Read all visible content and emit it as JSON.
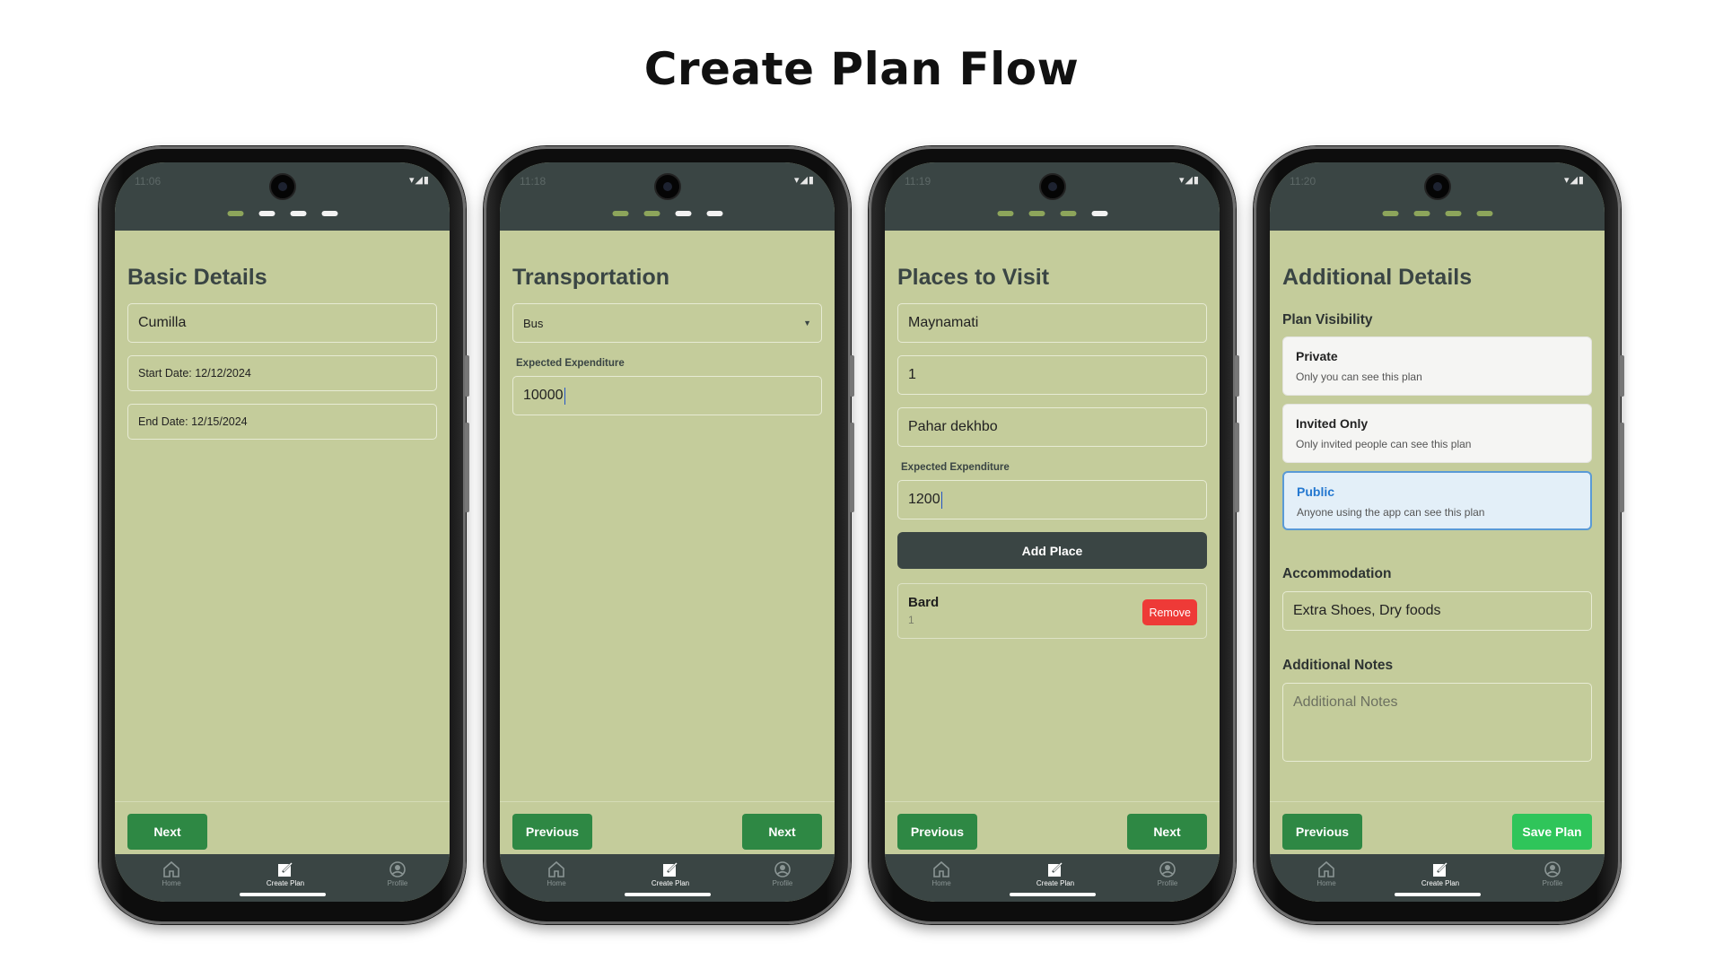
{
  "title": "Create Plan Flow",
  "tabs": {
    "home": "Home",
    "create": "Create Plan",
    "profile": "Profile"
  },
  "status_icons": "▾◢▮",
  "colors": {
    "accent_green": "#2e8844",
    "save_green": "#2fc55a",
    "header_dark": "#3a4544",
    "screen_bg": "#c4cc9b",
    "remove_red": "#ee3a37",
    "selected_blue": "#2478d0"
  },
  "screens": [
    {
      "time": "11:06",
      "step": 1,
      "heading": "Basic Details",
      "location": "Cumilla",
      "start_date": "Start Date: 12/12/2024",
      "end_date": "End Date: 12/15/2024",
      "next": "Next"
    },
    {
      "time": "11:18",
      "step": 2,
      "heading": "Transportation",
      "transport": "Bus",
      "expenditure_label": "Expected Expenditure",
      "expenditure": "10000",
      "previous": "Previous",
      "next": "Next"
    },
    {
      "time": "11:19",
      "step": 3,
      "heading": "Places to Visit",
      "place": "Maynamati",
      "day": "1",
      "activity": "Pahar dekhbo",
      "expenditure_label": "Expected Expenditure",
      "expenditure": "1200",
      "add_place": "Add Place",
      "added_place": {
        "name": "Bard",
        "day": "1",
        "remove": "Remove"
      },
      "previous": "Previous",
      "next": "Next"
    },
    {
      "time": "11:20",
      "step": 4,
      "heading": "Additional Details",
      "visibility_label": "Plan Visibility",
      "visibility_options": [
        {
          "title": "Private",
          "desc": "Only you can see this plan",
          "selected": false
        },
        {
          "title": "Invited Only",
          "desc": "Only invited people can see this plan",
          "selected": false
        },
        {
          "title": "Public",
          "desc": "Anyone using the app can see this plan",
          "selected": true
        }
      ],
      "accommodation_label": "Accommodation",
      "accommodation": "Extra Shoes, Dry foods",
      "notes_label": "Additional Notes",
      "notes_placeholder": "Additional Notes",
      "previous": "Previous",
      "save": "Save Plan"
    }
  ]
}
